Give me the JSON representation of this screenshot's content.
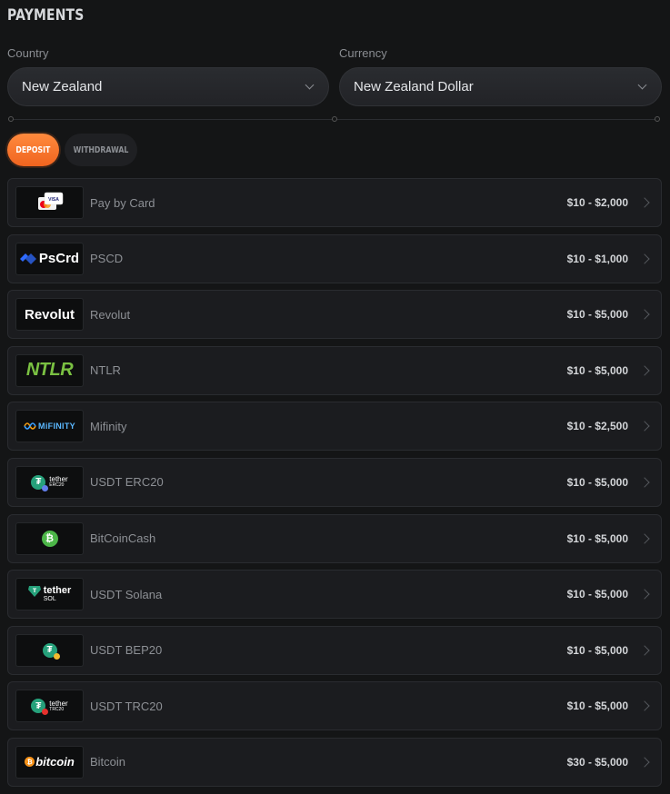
{
  "page": {
    "title": "PAYMENTS"
  },
  "filters": {
    "country": {
      "label": "Country",
      "value": "New Zealand"
    },
    "currency": {
      "label": "Currency",
      "value": "New Zealand Dollar"
    }
  },
  "tabs": [
    {
      "label": "DEPOSIT",
      "active": true
    },
    {
      "label": "WITHDRAWAL",
      "active": false
    }
  ],
  "methods": [
    {
      "name": "Pay by Card",
      "range": "$10 - $2,000",
      "logo": "card-icon"
    },
    {
      "name": "PSCD",
      "range": "$10 - $1,000",
      "logo": "pscrd-logo",
      "logo_text": "PsCrd"
    },
    {
      "name": "Revolut",
      "range": "$10 - $5,000",
      "logo": "revolut-logo",
      "logo_text": "Revolut"
    },
    {
      "name": "NTLR",
      "range": "$10 - $5,000",
      "logo": "ntlr-logo",
      "logo_text": "NTLR"
    },
    {
      "name": "Mifinity",
      "range": "$10 - $2,500",
      "logo": "mifinity-logo",
      "logo_text": "MiFINITY"
    },
    {
      "name": "USDT ERC20",
      "range": "$10 - $5,000",
      "logo": "tether-erc20-logo",
      "logo_text": "tether",
      "logo_sub": "ERC20"
    },
    {
      "name": "BitCoinCash",
      "range": "$10 - $5,000",
      "logo": "bitcoincash-logo"
    },
    {
      "name": "USDT Solana",
      "range": "$10 - $5,000",
      "logo": "tether-sol-logo",
      "logo_text": "tether",
      "logo_sub": "SOL"
    },
    {
      "name": "USDT BEP20",
      "range": "$10 - $5,000",
      "logo": "tether-bep20-logo"
    },
    {
      "name": "USDT TRC20",
      "range": "$10 - $5,000",
      "logo": "tether-trc20-logo",
      "logo_text": "tether",
      "logo_sub": "TRC20"
    },
    {
      "name": "Bitcoin",
      "range": "$30 - $5,000",
      "logo": "bitcoin-logo",
      "logo_text": "bitcoin"
    }
  ],
  "colors": {
    "accent": "#f0641f",
    "background": "#141516",
    "row": "#1b1c1f",
    "tether": "#26a17b"
  }
}
